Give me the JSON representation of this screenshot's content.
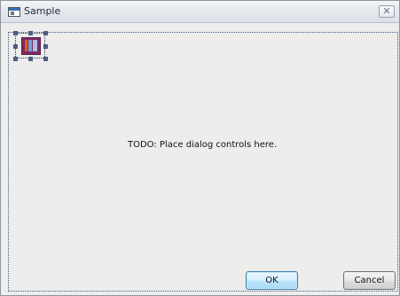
{
  "window": {
    "title": "Sample",
    "close_glyph": "✕"
  },
  "canvas": {
    "todo_text": "TODO: Place dialog controls here.",
    "placed_icon": "dialog-app-icon"
  },
  "buttons": {
    "ok_label": "OK",
    "cancel_label": "Cancel"
  },
  "colors": {
    "ok_border": "#3c7fb1",
    "selection": "#4d5e83",
    "icon_bg": "#7e2a66"
  }
}
